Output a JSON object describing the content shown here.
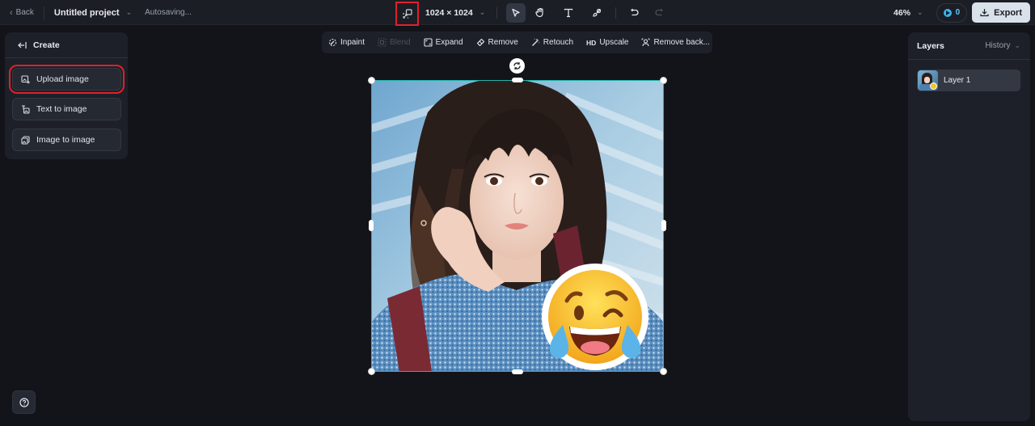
{
  "topbar": {
    "back_label": "Back",
    "project_name": "Untitled project",
    "save_status": "Autosaving...",
    "canvas_size": "1024 × 1024",
    "zoom_level": "46%",
    "credits": "0",
    "export_label": "Export",
    "tools": [
      {
        "name": "select",
        "icon": "cursor-arrow-icon",
        "active": true
      },
      {
        "name": "hand",
        "icon": "hand-icon",
        "active": false
      },
      {
        "name": "text",
        "icon": "text-icon",
        "active": false
      },
      {
        "name": "brush",
        "icon": "brush-icon",
        "active": false
      },
      {
        "name": "undo",
        "icon": "undo-icon",
        "active": false
      },
      {
        "name": "redo",
        "icon": "redo-icon",
        "active": false,
        "disabled": true
      }
    ]
  },
  "left_panel": {
    "title": "Create",
    "items": [
      {
        "label": "Upload image",
        "icon": "upload-image-icon",
        "highlighted": true
      },
      {
        "label": "Text to image",
        "icon": "text-to-image-icon"
      },
      {
        "label": "Image to image",
        "icon": "image-to-image-icon"
      }
    ]
  },
  "edit_toolbar": {
    "items": [
      {
        "label": "Inpaint",
        "icon": "inpaint-icon",
        "disabled": false
      },
      {
        "label": "Blend",
        "icon": "blend-icon",
        "disabled": true
      },
      {
        "label": "Expand",
        "icon": "expand-icon",
        "disabled": false
      },
      {
        "label": "Remove",
        "icon": "eraser-icon",
        "disabled": false
      },
      {
        "label": "Retouch",
        "icon": "magic-wand-icon",
        "disabled": false
      },
      {
        "label": "Upscale",
        "icon": "hd-icon",
        "prefix": "HD",
        "disabled": false
      },
      {
        "label": "Remove back...",
        "icon": "remove-background-icon",
        "disabled": false
      }
    ]
  },
  "right_panel": {
    "title": "Layers",
    "history_label": "History",
    "layers": [
      {
        "name": "Layer 1",
        "selected": true
      }
    ]
  },
  "canvas": {
    "image_description": "Portrait of a young woman with dark bangs, hand on cheek, denim jacket, with a laughing-crying winking emoji sticker",
    "selection_color": "#1fb6ad"
  },
  "colors": {
    "background": "#121419",
    "panel": "#1d2028",
    "accent": "#3cb6f0",
    "highlight_box": "#e0202a",
    "export_bg": "#d9e1ea"
  }
}
